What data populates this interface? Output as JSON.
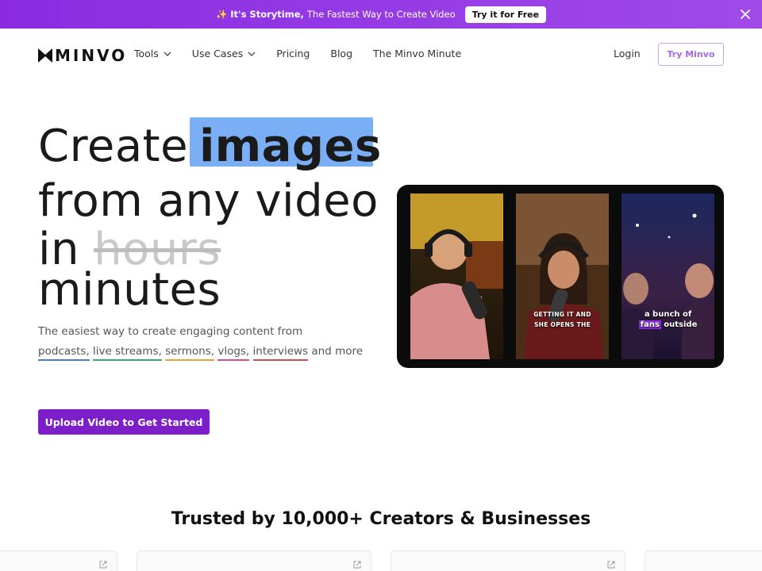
{
  "banner": {
    "spark": "✨",
    "bold": "It's Storytime,",
    "text": "The Fastest Way to Create Video",
    "cta": "Try it for Free"
  },
  "nav": {
    "logo": "MINVO",
    "items": [
      {
        "label": "Tools",
        "dropdown": true
      },
      {
        "label": "Use Cases",
        "dropdown": true
      },
      {
        "label": "Pricing",
        "dropdown": false
      },
      {
        "label": "Blog",
        "dropdown": false
      },
      {
        "label": "The Minvo Minute",
        "dropdown": false
      }
    ],
    "login": "Login",
    "try": "Try Minvo"
  },
  "hero": {
    "line1_prefix": "Create",
    "line1_highlight": "images",
    "line2": "from any video",
    "line3_prefix": "in",
    "line3_strike": "hours",
    "line4": "minutes",
    "desc_intro": "The easiest way to create engaging content from",
    "tags": [
      "podcasts,",
      "live streams,",
      "sermons,",
      "vlogs,",
      "interviews"
    ],
    "desc_outro": "and more",
    "cta": "Upload Video to Get Started"
  },
  "preview": {
    "caption2_line1": "GETTING IT AND",
    "caption2_line2": "SHE OPENS THE",
    "caption3_line1": "a bunch of",
    "caption3_fans": "fans",
    "caption3_rest": "outside"
  },
  "trusted": {
    "title": "Trusted by 10,000+ Creators & Businesses"
  },
  "colors": {
    "brand_purple": "#7c1fc9",
    "highlight_blue": "#7aaef5"
  }
}
